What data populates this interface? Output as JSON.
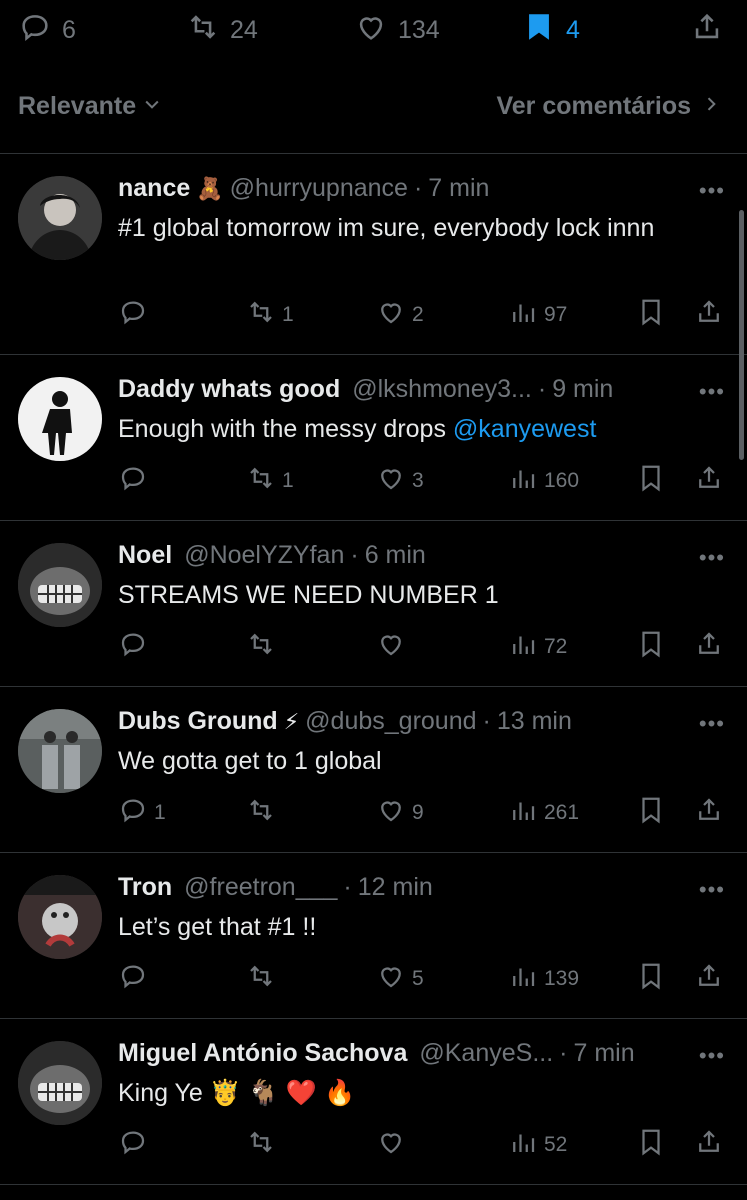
{
  "top_actions": {
    "replies": "6",
    "reposts": "24",
    "likes": "134",
    "bookmarks": "4"
  },
  "sort": {
    "label": "Relevante",
    "view_comments": "Ver comentários"
  },
  "colors": {
    "background": "#000000",
    "text": "#e7e9ea",
    "muted": "#71767b",
    "accent": "#1d9bf0",
    "divider": "#2f3336"
  },
  "replies": [
    {
      "name": "nance",
      "name_emoji": "🧸",
      "handle": "@hurryupnance",
      "time": "7 min",
      "text": "#1 global tomorrow im sure, everybody lock innn",
      "mention": "",
      "replies": "",
      "reposts": "1",
      "likes": "2",
      "views": "97"
    },
    {
      "name": "Daddy whats good",
      "name_emoji": "",
      "handle": "@lkshmoney3...",
      "time": "9 min",
      "text": "Enough with the messy drops ",
      "mention": "@kanyewest",
      "replies": "",
      "reposts": "1",
      "likes": "3",
      "views": "160"
    },
    {
      "name": "Noel",
      "name_emoji": "",
      "handle": "@NoelYZYfan",
      "time": "6 min",
      "text": "STREAMS WE NEED NUMBER 1",
      "mention": "",
      "replies": "",
      "reposts": "",
      "likes": "",
      "views": "72"
    },
    {
      "name": "Dubs Ground",
      "name_emoji": "⚡",
      "handle": "@dubs_ground",
      "time": "13 min",
      "text": "We gotta get to 1 global",
      "mention": "",
      "replies": "1",
      "reposts": "",
      "likes": "9",
      "views": "261"
    },
    {
      "name": "Tron",
      "name_emoji": "",
      "handle": "@freetron___",
      "time": "12 min",
      "text": "Let’s get that #1 !!",
      "mention": "",
      "replies": "",
      "reposts": "",
      "likes": "5",
      "views": "139"
    },
    {
      "name": "Miguel António Sachova",
      "name_emoji": "",
      "handle": "@KanyeS...",
      "time": "7 min",
      "text": "King Ye 🤴 🐐 ❤️ 🔥",
      "mention": "",
      "replies": "",
      "reposts": "",
      "likes": "",
      "views": "52"
    }
  ]
}
